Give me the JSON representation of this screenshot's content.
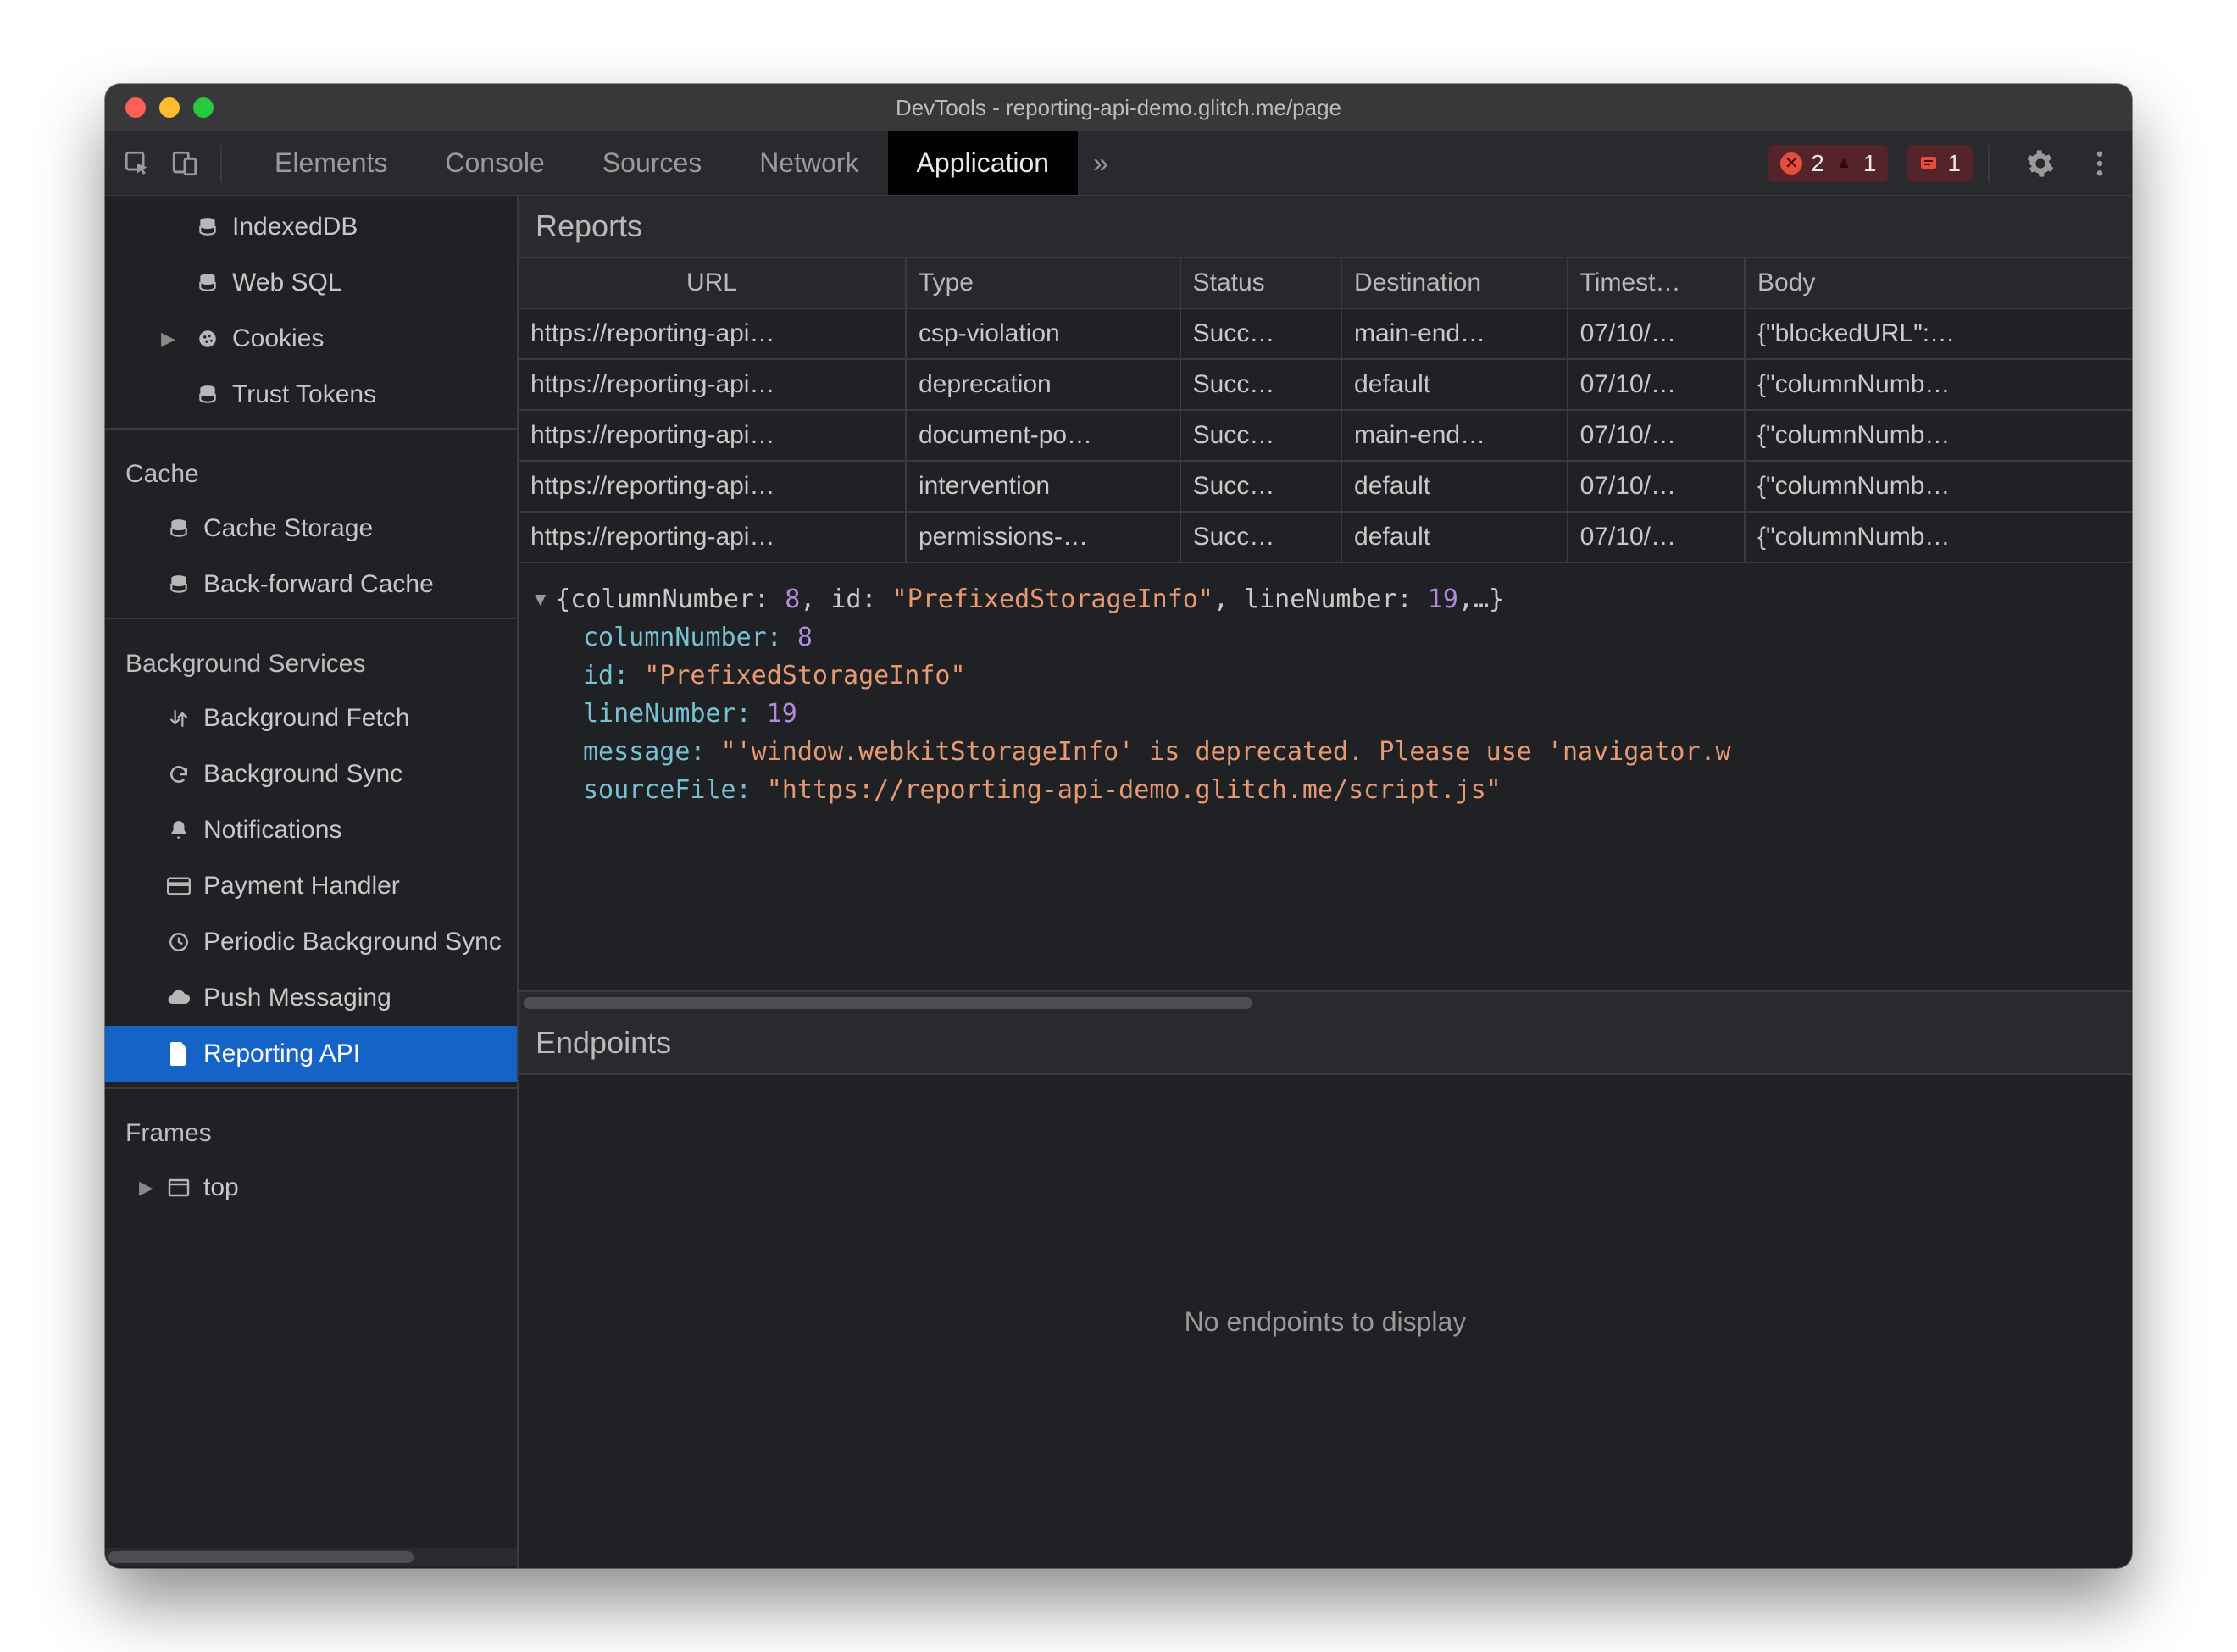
{
  "window": {
    "title": "DevTools - reporting-api-demo.glitch.me/page"
  },
  "toolbar": {
    "tabs": [
      "Elements",
      "Console",
      "Sources",
      "Network",
      "Application"
    ],
    "active_tab_index": 4,
    "overflow_glyph": "»",
    "error_count": "2",
    "warn_count": "1",
    "issue_count": "1"
  },
  "sidebar": {
    "storage": {
      "items": [
        {
          "label": "IndexedDB",
          "icon": "database-icon"
        },
        {
          "label": "Web SQL",
          "icon": "database-icon"
        },
        {
          "label": "Cookies",
          "icon": "cookie-icon",
          "expandable": true
        },
        {
          "label": "Trust Tokens",
          "icon": "database-icon"
        }
      ]
    },
    "cache": {
      "title": "Cache",
      "items": [
        {
          "label": "Cache Storage",
          "icon": "database-icon"
        },
        {
          "label": "Back-forward Cache",
          "icon": "database-icon"
        }
      ]
    },
    "background": {
      "title": "Background Services",
      "items": [
        {
          "label": "Background Fetch",
          "icon": "updown-icon"
        },
        {
          "label": "Background Sync",
          "icon": "sync-icon"
        },
        {
          "label": "Notifications",
          "icon": "bell-icon"
        },
        {
          "label": "Payment Handler",
          "icon": "card-icon"
        },
        {
          "label": "Periodic Background Sync",
          "icon": "clock-icon"
        },
        {
          "label": "Push Messaging",
          "icon": "cloud-icon"
        },
        {
          "label": "Reporting API",
          "icon": "file-icon",
          "selected": true
        }
      ]
    },
    "frames": {
      "title": "Frames",
      "items": [
        {
          "label": "top",
          "icon": "frame-icon",
          "expandable": true
        }
      ]
    }
  },
  "reports": {
    "title": "Reports",
    "columns": [
      "URL",
      "Type",
      "Status",
      "Destination",
      "Timest…",
      "Body"
    ],
    "rows": [
      {
        "url": "https://reporting-api…",
        "type": "csp-violation",
        "status": "Succ…",
        "dest": "main-end…",
        "ts": "07/10/…",
        "body": "{\"blockedURL\":…"
      },
      {
        "url": "https://reporting-api…",
        "type": "deprecation",
        "status": "Succ…",
        "dest": "default",
        "ts": "07/10/…",
        "body": "{\"columnNumb…"
      },
      {
        "url": "https://reporting-api…",
        "type": "document-po…",
        "status": "Succ…",
        "dest": "main-end…",
        "ts": "07/10/…",
        "body": "{\"columnNumb…"
      },
      {
        "url": "https://reporting-api…",
        "type": "intervention",
        "status": "Succ…",
        "dest": "default",
        "ts": "07/10/…",
        "body": "{\"columnNumb…"
      },
      {
        "url": "https://reporting-api…",
        "type": "permissions-…",
        "status": "Succ…",
        "dest": "default",
        "ts": "07/10/…",
        "body": "{\"columnNumb…"
      }
    ]
  },
  "detail": {
    "header_prefix": "{columnNumber: ",
    "header_col": "8",
    "header_mid1": ", id: ",
    "header_id": "\"PrefixedStorageInfo\"",
    "header_mid2": ", lineNumber: ",
    "header_line": "19",
    "header_suffix": ",…}",
    "k_columnNumber": "columnNumber:",
    "v_columnNumber": "8",
    "k_id": "id:",
    "v_id": "\"PrefixedStorageInfo\"",
    "k_lineNumber": "lineNumber:",
    "v_lineNumber": "19",
    "k_message": "message:",
    "v_message": "\"'window.webkitStorageInfo' is deprecated. Please use 'navigator.w",
    "k_sourceFile": "sourceFile:",
    "v_sourceFile": "\"https://reporting-api-demo.glitch.me/script.js\""
  },
  "endpoints": {
    "title": "Endpoints",
    "empty": "No endpoints to display"
  }
}
